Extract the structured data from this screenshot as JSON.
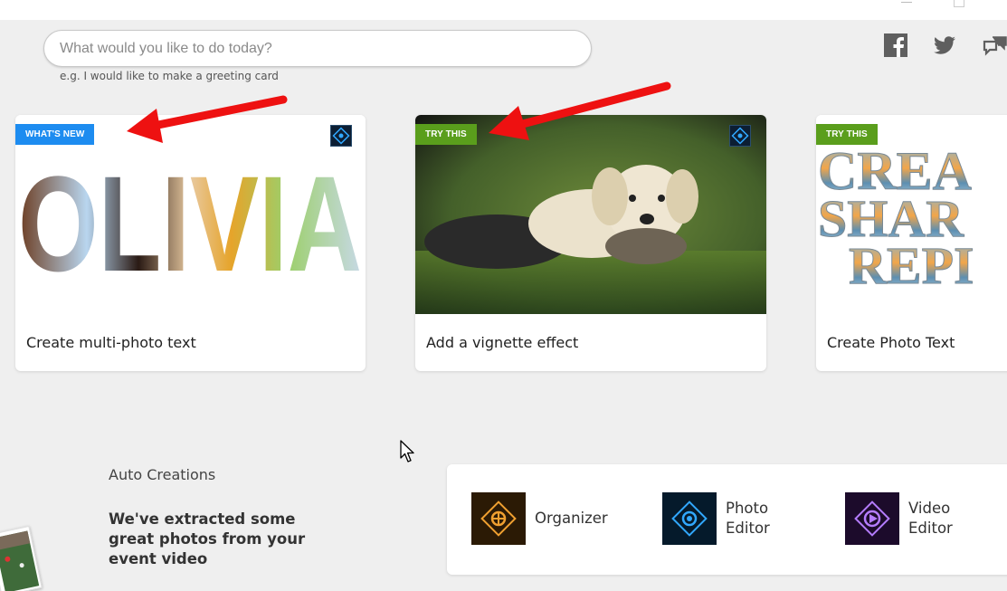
{
  "search": {
    "placeholder": "What would you like to do today?",
    "hint": "e.g. I would like to make a greeting card"
  },
  "social": {
    "facebook_icon": "facebook-icon",
    "twitter_icon": "twitter-icon",
    "feedback_icon": "feedback-icon"
  },
  "cards": [
    {
      "badge": "WHAT'S NEW",
      "badge_color": "#1d8cf0",
      "label": "Create multi-photo text",
      "image_text": "OLIVIA"
    },
    {
      "badge": "TRY THIS",
      "badge_color": "#5a9e1c",
      "label": "Add a vignette effect"
    },
    {
      "badge": "TRY THIS",
      "badge_color": "#5a9e1c",
      "label": "Create Photo Text",
      "image_lines": [
        "CREA",
        "SHAR",
        "REPI"
      ]
    }
  ],
  "auto_creations": {
    "title": "Auto Creations",
    "description": "We've extracted some great photos from your event video"
  },
  "apps": [
    {
      "label": "Organizer",
      "icon": "organizer-icon",
      "color": "#f0a030"
    },
    {
      "label": "Photo Editor",
      "icon": "photo-editor-icon",
      "color": "#31a8ff"
    },
    {
      "label": "Video Editor",
      "icon": "video-editor-icon",
      "color": "#b47cff"
    }
  ],
  "colors": {
    "annotation_arrow": "#ee1111",
    "page_background": "#efefef"
  }
}
